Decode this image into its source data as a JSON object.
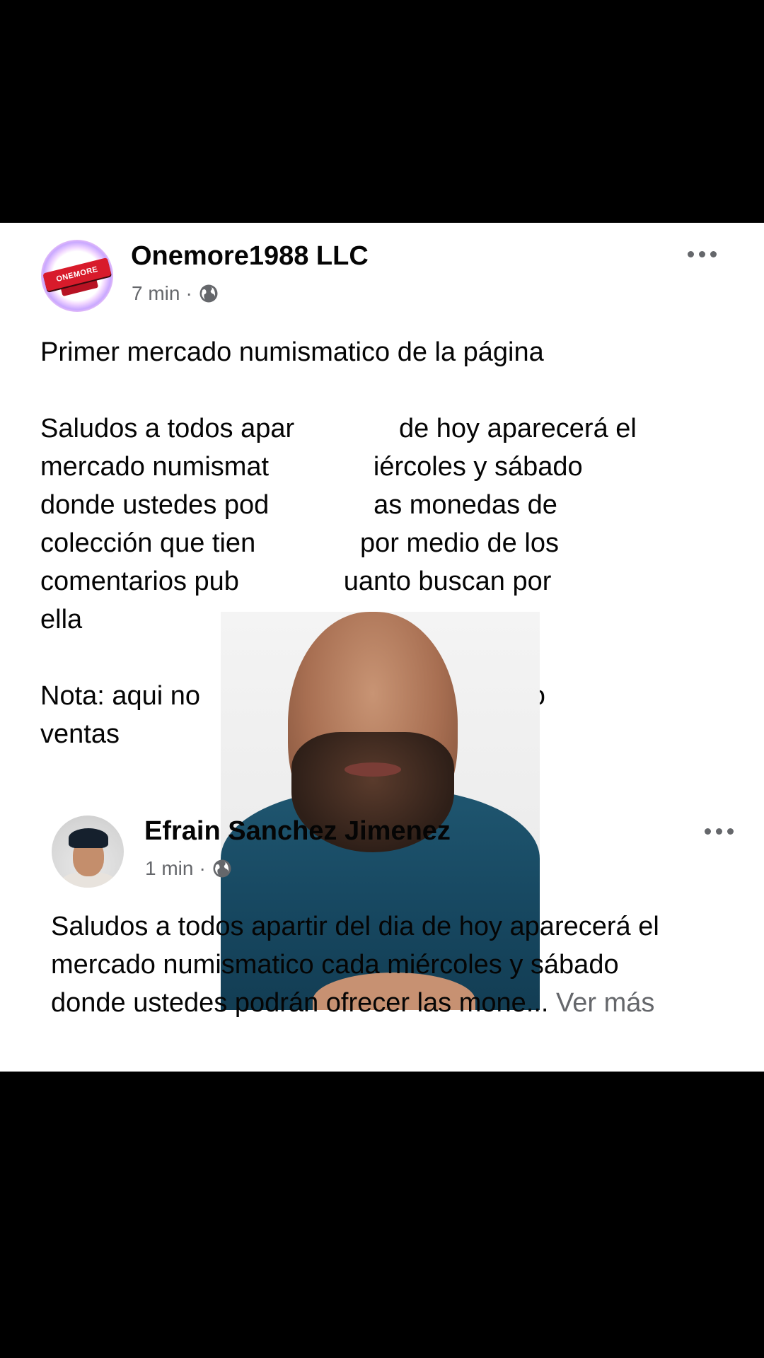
{
  "post": {
    "author": "Onemore1988 LLC",
    "time": "7 min",
    "separator": "·",
    "avatar_logo_text": "ONEMORE",
    "text": "Primer mercado numismatico de la página\n\nSaludos a todos apar              de hoy aparecerá el\nmercado numismat              iércoles y sábado\ndonde ustedes pod              as monedas de\ncolección que tien              por medio de los\ncomentarios pub              uanto buscan por\nella\n\nNota: aqui no                           valores solo\nventas",
    "icons": {
      "more": "more-horizontal-icon",
      "audience": "globe-icon"
    }
  },
  "comment": {
    "author": "Efrain Sanchez Jimenez",
    "time": "1 min",
    "separator": "·",
    "text": "Saludos a todos apartir del dia de hoy aparecerá el\nmercado numismatico cada miércoles y sábado\ndonde ustedes podrán ofrecer las mone... ",
    "see_more": "Ver más"
  },
  "colors": {
    "background": "#000000",
    "card": "#ffffff",
    "meta": "#65676b",
    "hoodie": "#1f5670"
  }
}
